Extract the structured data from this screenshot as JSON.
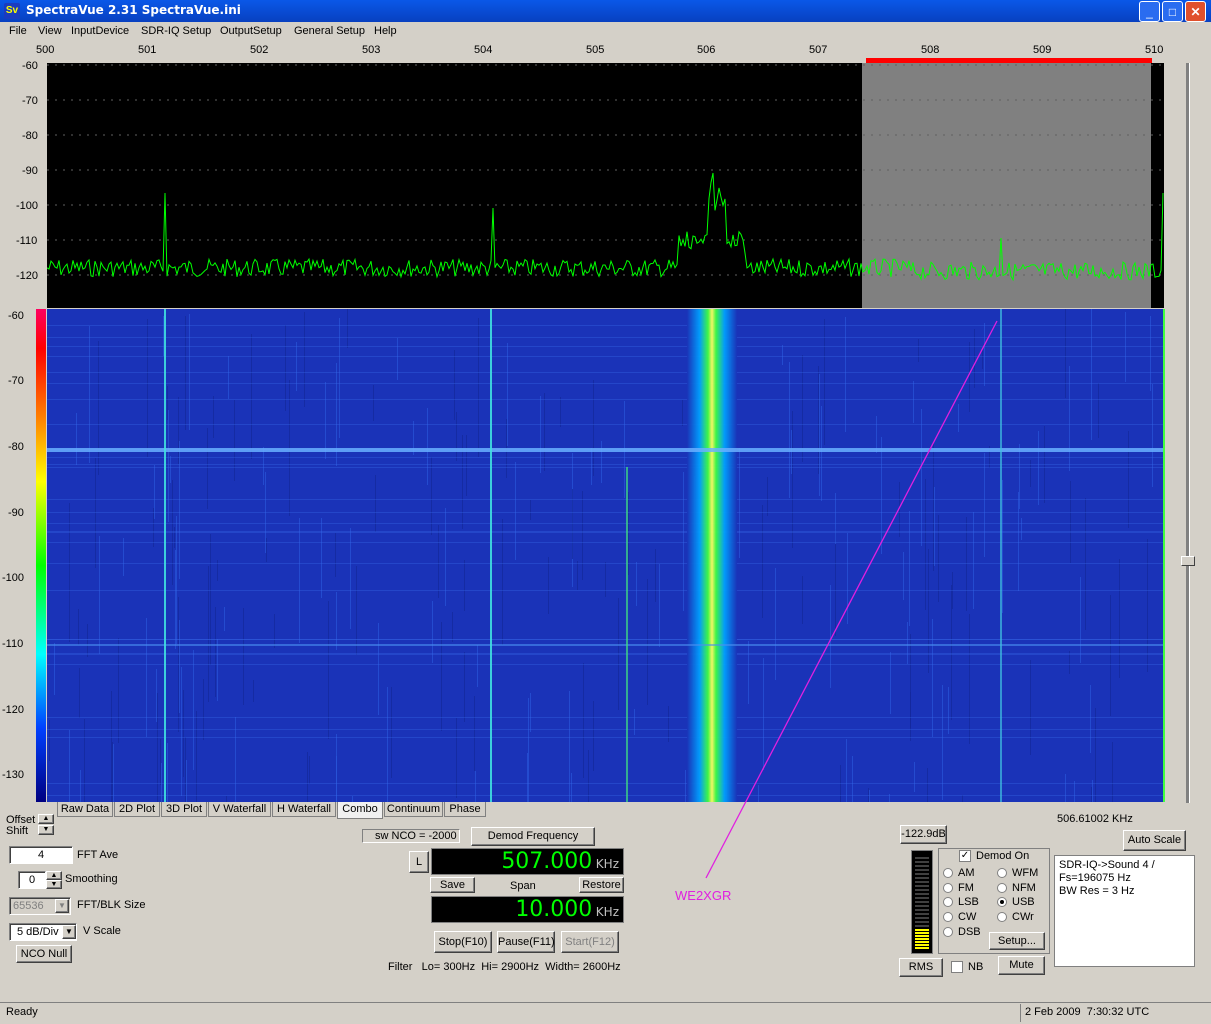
{
  "window": {
    "title": "SpectraVue 2.31  SpectraVue.ini",
    "icon_text": "Sv"
  },
  "menu": [
    "File",
    "View",
    "InputDevice",
    "SDR-IQ Setup",
    "OutputSetup",
    "General Setup",
    "Help"
  ],
  "freq_axis": [
    "500",
    "501",
    "502",
    "503",
    "504",
    "505",
    "506",
    "507",
    "508",
    "509",
    "510"
  ],
  "spectrum_db_labels": [
    "-60",
    "-70",
    "-80",
    "-90",
    "-100",
    "-110",
    "-120"
  ],
  "waterfall_db_labels": [
    "-60",
    "-70",
    "-80",
    "-90",
    "-100",
    "-110",
    "-120",
    "-130"
  ],
  "tabs": [
    "Raw Data",
    "2D Plot",
    "3D Plot",
    "V Waterfall",
    "H Waterfall",
    "Combo",
    "Continuum",
    "Phase"
  ],
  "active_tab": "Combo",
  "left_controls": {
    "offset_label": "Offset",
    "shift_label": "Shift",
    "fft_ave_value": "4",
    "fft_ave_label": "FFT Ave",
    "smoothing_value": "0",
    "smoothing_label": "Smoothing",
    "fft_blk_value": "65536",
    "fft_blk_label": "FFT/BLK Size",
    "vscale_value": "5 dB/Div",
    "vscale_label": "V Scale",
    "nco_null": "NCO Null"
  },
  "center_controls": {
    "sw_nco": "sw NCO = -2000",
    "demod_freq_btn": "Demod Frequency",
    "l_btn": "L",
    "center_freq": "507.000",
    "center_unit": "KHz",
    "save": "Save",
    "span_label": "Span",
    "restore": "Restore",
    "span_value": "10.000",
    "span_unit": "KHz",
    "stop": "Stop(F10)",
    "pause": "Pause(F11)",
    "start": "Start(F12)",
    "filter_text": "Filter   Lo= 300Hz  Hi= 2900Hz  Width= 2600Hz"
  },
  "annotation": {
    "text": "WE2XGR",
    "color": "#e020e0"
  },
  "right_controls": {
    "level": "-122.9dB",
    "freq_readout": "506.61002 KHz",
    "auto_scale": "Auto Scale",
    "demod_on": "Demod On",
    "modes_left": [
      "AM",
      "FM",
      "LSB",
      "CW",
      "DSB"
    ],
    "modes_right": [
      "WFM",
      "NFM",
      "USB",
      "CWr"
    ],
    "selected_mode": "USB",
    "setup": "Setup...",
    "rms": "RMS",
    "nb": "NB",
    "mute": "Mute",
    "info_lines": [
      "SDR-IQ->Sound 4  /",
      "Fs=196075 Hz",
      "BW Res =    3 Hz"
    ]
  },
  "status": {
    "left": "Ready",
    "right": "2 Feb 2009  7:30:32 UTC"
  },
  "colors": {
    "spectrum_trace": "#00ff00",
    "marker_bar": "#ff0000",
    "waterfall_bg": "#1a33b8",
    "signal": "#40ff40"
  }
}
